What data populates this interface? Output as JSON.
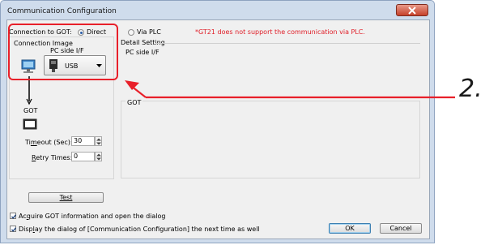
{
  "window": {
    "title": "Communication Configuration"
  },
  "connection": {
    "label": "Connection to GOT:",
    "direct_label": "Direct",
    "via_plc_label": "Via PLC",
    "note": "*GT21 does not support the communication via PLC.",
    "note_color": "#e0202a"
  },
  "image": {
    "section_label": "Connection Image",
    "pc_side_if_label": "PC side I/F",
    "interface_value": "USB",
    "got_label": "GOT"
  },
  "detail": {
    "heading": "Detail Setting",
    "pc_side_if_label": "PC side I/F",
    "got_label": "GOT"
  },
  "timeout": {
    "label_pre": "Ti",
    "label_u": "m",
    "label_post": "eout (Sec):",
    "value": "30"
  },
  "retry": {
    "label_u": "R",
    "label_post": "etry Times:",
    "value": "0"
  },
  "test_button": {
    "label": "Test"
  },
  "options": {
    "acquire": {
      "pre": "Ac",
      "u": "q",
      "post": "uire GOT information and open the dialog",
      "checked": true
    },
    "display": {
      "pre": "Disp",
      "u": "l",
      "post": "ay the dialog of [Communication Configuration] the next time as well",
      "checked": true
    }
  },
  "ok_button": {
    "label": "OK"
  },
  "cancel_button": {
    "label": "Cancel"
  },
  "annotation": {
    "label": "2.",
    "highlight_color": "#e8202a"
  }
}
